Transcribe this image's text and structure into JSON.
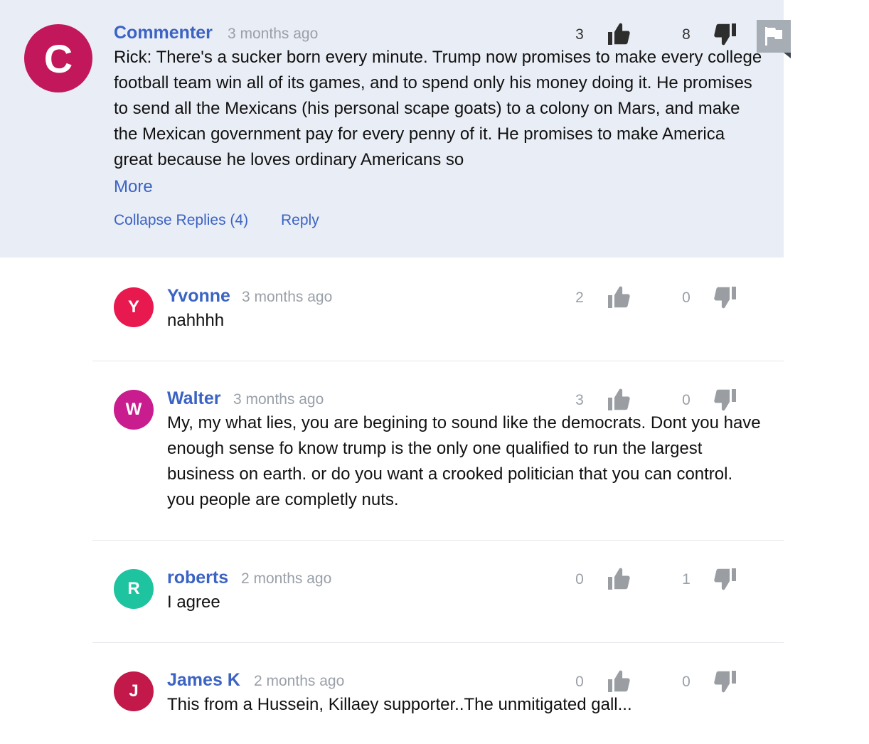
{
  "main_comment": {
    "author": "Commenter",
    "avatar_letter": "C",
    "avatar_color": "#c2185b",
    "time": "3 months ago",
    "body": "Rick: There's a sucker born every minute. Trump now promises to make every college football team win all of its games, and to spend only his money doing it. He promises to send all the Mexicans (his personal scape goats) to a colony on Mars, and make the Mexican government pay for every penny of it. He promises to make America great because he loves ordinary Americans so",
    "more_label": "More",
    "upvotes": "3",
    "downvotes": "8",
    "collapse_label": "Collapse Replies (4)",
    "reply_label": "Reply"
  },
  "replies": [
    {
      "author": "Yvonne",
      "avatar_letter": "Y",
      "avatar_color": "#e8194f",
      "time": "3 months ago",
      "body": "nahhhh",
      "upvotes": "2",
      "downvotes": "0"
    },
    {
      "author": "Walter",
      "avatar_letter": "W",
      "avatar_color": "#c91c8e",
      "time": "3 months ago",
      "body": "My, my what lies, you are begining to sound like the democrats. Dont you have enough sense fo know trump is the only one qualified to run the largest business on earth. or do you want a crooked politician that you can control. you people are completly nuts.",
      "upvotes": "3",
      "downvotes": "0"
    },
    {
      "author": "roberts",
      "avatar_letter": "R",
      "avatar_color": "#1ec3a0",
      "time": "2 months ago",
      "body": "I agree",
      "upvotes": "0",
      "downvotes": "1"
    },
    {
      "author": "James K",
      "avatar_letter": "J",
      "avatar_color": "#c2184a",
      "time": "2 months ago",
      "body": "This from a Hussein, Killaey supporter..The unmitigated gall...",
      "upvotes": "0",
      "downvotes": "0"
    }
  ],
  "icons": {
    "thumbs_up": "thumbs-up-icon",
    "thumbs_down": "thumbs-down-icon",
    "flag": "flag-icon"
  },
  "colors": {
    "link": "#3b63c4",
    "main_background": "#e9edf5",
    "flag_button": "#a7adb5"
  }
}
